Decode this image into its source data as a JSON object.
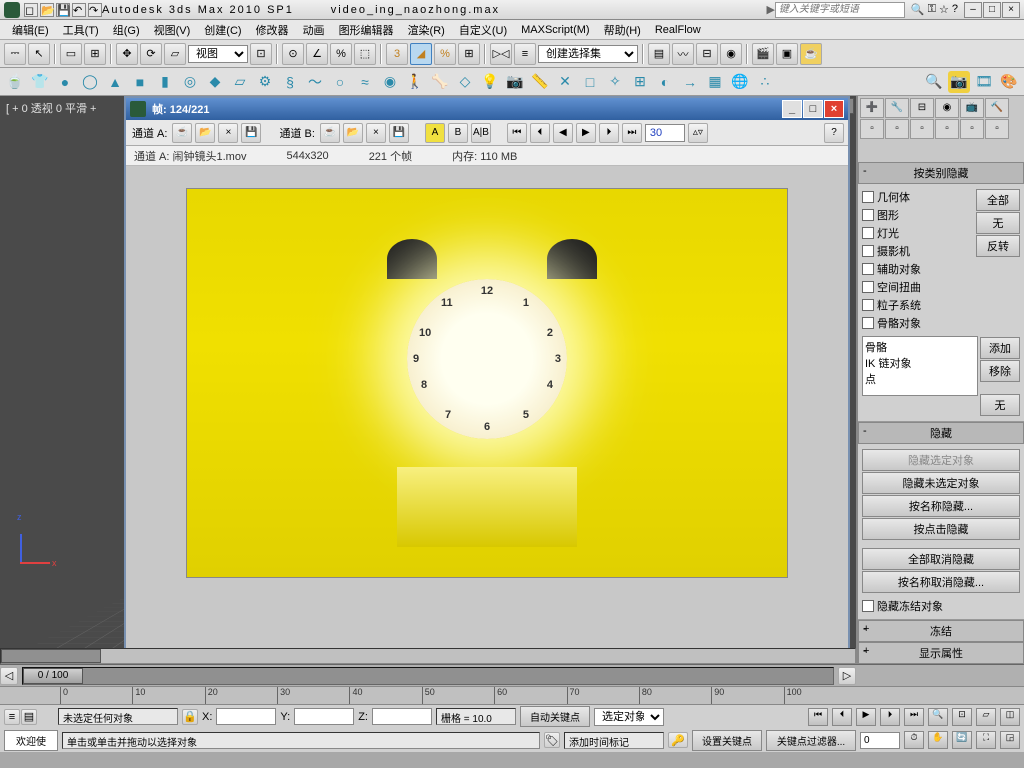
{
  "titlebar": {
    "app": "Autodesk 3ds Max  2010 SP1",
    "file": "video_ing_naozhong.max",
    "search_placeholder": "键入关键字或短语"
  },
  "menus": [
    "编辑(E)",
    "工具(T)",
    "组(G)",
    "视图(V)",
    "创建(C)",
    "修改器",
    "动画",
    "图形编辑器",
    "渲染(R)",
    "自定义(U)",
    "MAXScript(M)",
    "帮助(H)",
    "RealFlow"
  ],
  "toolbar1": {
    "view_combo": "视图",
    "selset_combo": "创建选择集"
  },
  "viewport": {
    "label": "[ + 0 透视 0 平滑 +"
  },
  "ram_player": {
    "title": "帧:  124/221",
    "channel_a": "通道 A:",
    "channel_b": "通道 B:",
    "ab_a": "A",
    "ab_b": "B",
    "ab_ab": "A|B",
    "frame_field": "30",
    "info_file": "通道 A: 闹钟镜头1.mov",
    "info_res": "544x320",
    "info_frames": "221 个帧",
    "info_mem": "内存: 110 MB",
    "clock_numbers": [
      "12",
      "1",
      "2",
      "3",
      "4",
      "5",
      "6",
      "7",
      "8",
      "9",
      "10",
      "11"
    ]
  },
  "panel": {
    "filter_header": "按类别隐藏",
    "categories": [
      "几何体",
      "图形",
      "灯光",
      "摄影机",
      "辅助对象",
      "空间扭曲",
      "粒子系统",
      "骨骼对象"
    ],
    "btn_all": "全部",
    "btn_none": "无",
    "btn_invert": "反转",
    "bones_list": [
      "骨骼",
      "IK 链对象",
      "点"
    ],
    "btn_add": "添加",
    "btn_remove": "移除",
    "btn_none2": "无",
    "hide_header": "隐藏",
    "hide_btns": [
      "隐藏选定对象",
      "隐藏未选定对象",
      "按名称隐藏...",
      "按点击隐藏",
      "全部取消隐藏",
      "按名称取消隐藏..."
    ],
    "hide_frozen": "隐藏冻结对象",
    "freeze_header": "冻结",
    "disp_header": "显示属性"
  },
  "timeline": {
    "thumb": "0 / 100",
    "ticks": [
      "0",
      "10",
      "20",
      "30",
      "40",
      "50",
      "60",
      "70",
      "80",
      "90",
      "100"
    ]
  },
  "status": {
    "welcome": "欢迎使",
    "no_sel": "未选定任何对象",
    "hint": "单击或单击并拖动以选择对象",
    "x": "X:",
    "y": "Y:",
    "z": "Z:",
    "grid": "栅格 = 10.0",
    "add_marker": "添加时间标记",
    "autokey": "自动关键点",
    "selset": "选定对象",
    "setkey": "设置关键点",
    "keyfilter": "关键点过滤器..."
  }
}
